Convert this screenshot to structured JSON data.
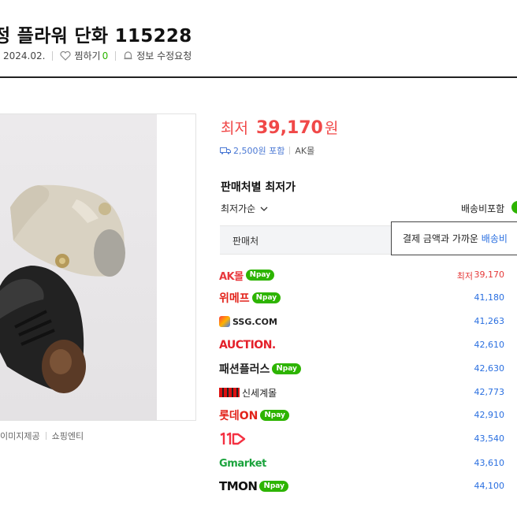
{
  "product": {
    "title": "정 플라워 단화 115228",
    "registered": "2024.02.",
    "wish_label": "찜하기",
    "wish_count": "0",
    "edit_request": "정보 수정요청"
  },
  "image": {
    "credit_left": "이미지제공",
    "credit_right": "쇼핑엔티"
  },
  "price": {
    "label": "최저",
    "value": "39,170",
    "unit": "원",
    "delivery": "2,500원 포함",
    "mall": "AK몰"
  },
  "sellers_section": {
    "title": "판매처별 최저가",
    "sort_label": "최저가순",
    "ship_toggle_label": "배송비포함",
    "column_header": "판매처",
    "tooltip_text": "결제 금액과 가까운",
    "tooltip_highlight": "배송비",
    "lowest_badge": "최저",
    "npay_label": "pay",
    "npay_n": "N"
  },
  "sellers": [
    {
      "name": "AK몰",
      "price": "39,170",
      "npay": true,
      "lowest": true
    },
    {
      "name": "위메프",
      "price": "41,180",
      "npay": true
    },
    {
      "name": "SSG.COM",
      "price": "41,263",
      "npay": false
    },
    {
      "name": "AUCTION.",
      "price": "42,610",
      "npay": false
    },
    {
      "name": "패션플러스",
      "price": "42,630",
      "npay": true
    },
    {
      "name": "신세계몰",
      "price": "42,773",
      "npay": false
    },
    {
      "name": "롯데ON",
      "price": "42,910",
      "npay": true
    },
    {
      "name": "11번가",
      "price": "43,540",
      "npay": false
    },
    {
      "name": "Gmarket",
      "price": "43,610",
      "npay": false
    },
    {
      "name": "TMON",
      "price": "44,100",
      "npay": true
    }
  ],
  "colors": {
    "accent_red": "#f04848",
    "link_blue": "#2a6fe0",
    "npay_green": "#2db400"
  }
}
